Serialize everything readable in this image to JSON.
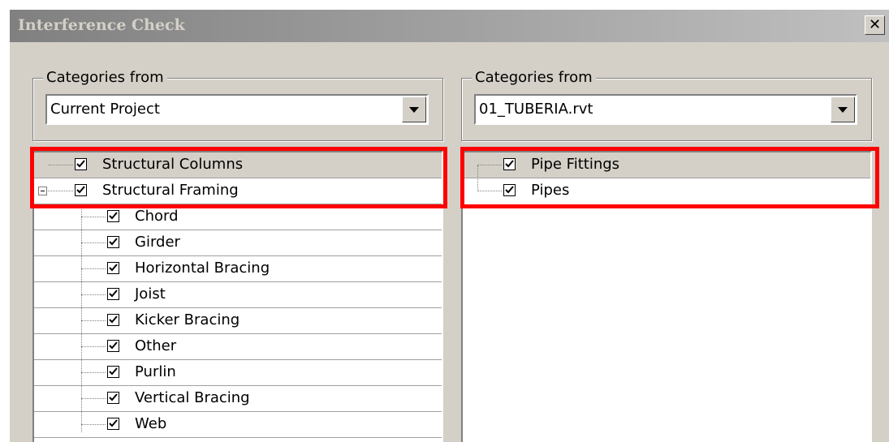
{
  "dialog": {
    "title": "Interference Check"
  },
  "left": {
    "group_label": "Categories from",
    "combo_value": "Current Project",
    "items": [
      {
        "label": "Structural Columns",
        "checked": true
      },
      {
        "label": "Structural Framing",
        "checked": true
      },
      {
        "label": "Chord",
        "checked": true
      },
      {
        "label": "Girder",
        "checked": true
      },
      {
        "label": "Horizontal Bracing",
        "checked": true
      },
      {
        "label": "Joist",
        "checked": true
      },
      {
        "label": "Kicker Bracing",
        "checked": true
      },
      {
        "label": "Other",
        "checked": true
      },
      {
        "label": "Purlin",
        "checked": true
      },
      {
        "label": "Vertical Bracing",
        "checked": true
      },
      {
        "label": "Web",
        "checked": true
      }
    ]
  },
  "right": {
    "group_label": "Categories from",
    "combo_value": "01_TUBERIA.rvt",
    "items": [
      {
        "label": "Pipe Fittings",
        "checked": true
      },
      {
        "label": "Pipes",
        "checked": true
      }
    ]
  },
  "highlight_color": "#ff0000"
}
